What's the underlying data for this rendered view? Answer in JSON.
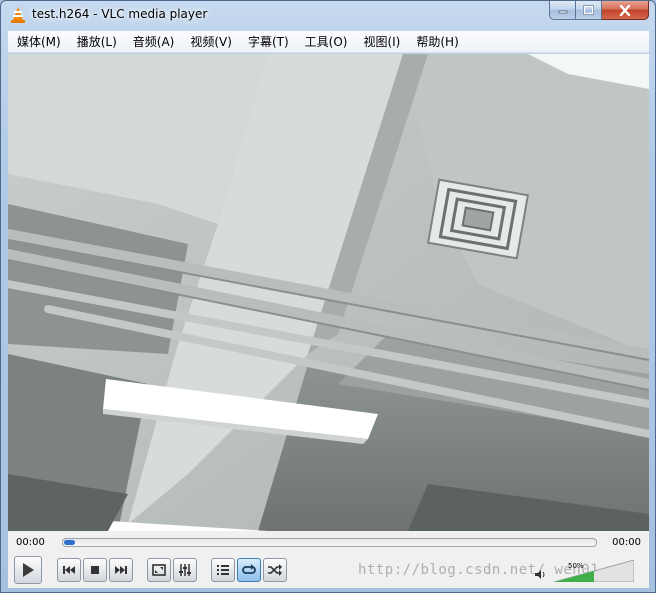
{
  "window": {
    "title": "test.h264 - VLC media player"
  },
  "menu": {
    "items": [
      "媒体(M)",
      "播放(L)",
      "音频(A)",
      "视频(V)",
      "字幕(T)",
      "工具(O)",
      "视图(I)",
      "帮助(H)"
    ]
  },
  "player": {
    "elapsed": "00:00",
    "total": "00:00",
    "progress": 0.02,
    "volume_percent": "50%",
    "volume_level": 0.5
  },
  "video": {
    "description_icon": "video-frame"
  },
  "watermark": {
    "text": "http://blog.csdn.net/  wen01"
  },
  "colors": {
    "accent": "#2e6dcc",
    "volume": "#42b04a",
    "vlc_orange": "#f28a0c"
  }
}
